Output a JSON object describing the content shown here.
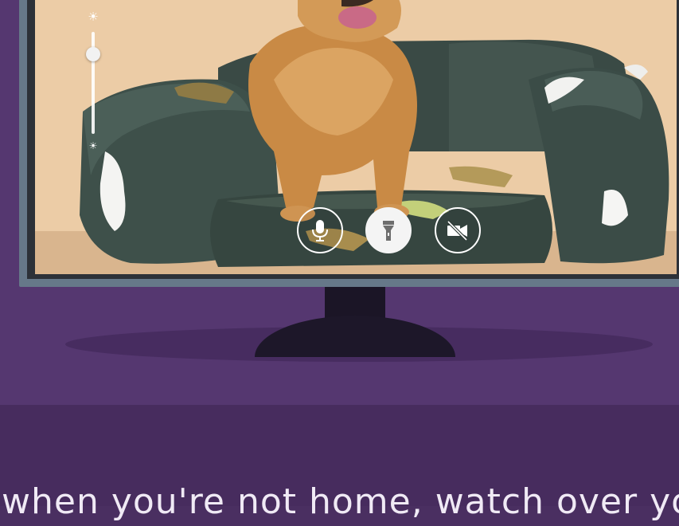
{
  "camera": {
    "brightness_level": 0.78,
    "controls": [
      {
        "id": "microphone",
        "icon": "microphone-icon",
        "state": "off"
      },
      {
        "id": "flashlight",
        "icon": "flashlight-icon",
        "state": "on"
      },
      {
        "id": "video",
        "icon": "video-off-icon",
        "state": "off"
      }
    ]
  },
  "icons": {
    "brightness_high": "sun-icon",
    "brightness_low": "sun-small-icon"
  },
  "caption": {
    "text": "when you're not home, watch over your dog at home"
  },
  "colors": {
    "background_upper": "#553770",
    "background_lower": "#472c5e",
    "monitor_frame": "#667889",
    "stand": "#1d1729"
  }
}
